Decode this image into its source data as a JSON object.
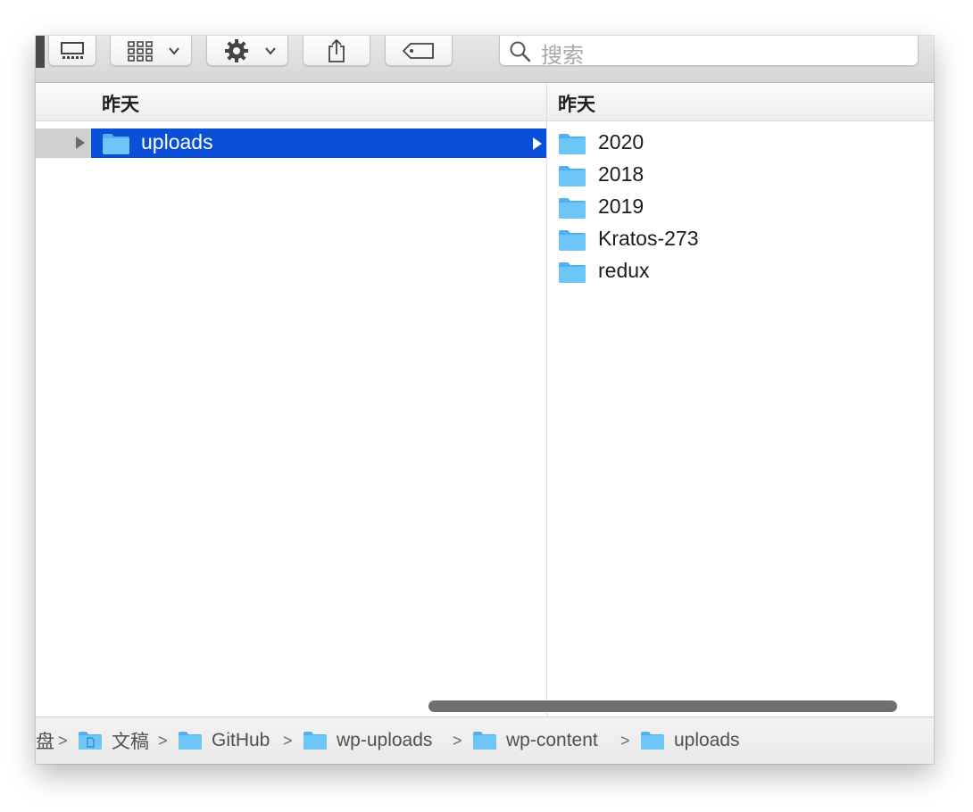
{
  "toolbar": {
    "buttons": [
      {
        "name": "cover-flow-view",
        "icon": "cover-flow-icon"
      },
      {
        "name": "group-view",
        "icon": "grid-icon"
      },
      {
        "name": "action-menu",
        "icon": "gear-icon"
      },
      {
        "name": "share",
        "icon": "share-icon"
      },
      {
        "name": "tags",
        "icon": "tag-icon"
      }
    ],
    "search_placeholder": "搜索"
  },
  "columns": [
    {
      "header": "",
      "selected": true
    },
    {
      "header": "昨天",
      "items": [
        {
          "label": "uploads",
          "selected": true
        }
      ]
    },
    {
      "header": "昨天",
      "items": [
        {
          "label": "2020"
        },
        {
          "label": "2018"
        },
        {
          "label": "2019"
        },
        {
          "label": "Kratos-273"
        },
        {
          "label": "redux"
        }
      ]
    }
  ],
  "pathbar": [
    {
      "label": "盘",
      "icon": "drive-icon"
    },
    {
      "label": "文稿",
      "icon": "documents-folder-icon"
    },
    {
      "label": "GitHub",
      "icon": "folder-icon"
    },
    {
      "label": "wp-uploads",
      "icon": "folder-icon"
    },
    {
      "label": "wp-content",
      "icon": "folder-icon"
    },
    {
      "label": "uploads",
      "icon": "folder-icon"
    }
  ],
  "pathbar_separator": ">",
  "colors": {
    "selection": "#0a4fd8",
    "folder": "#6ec6f8",
    "folder_dark": "#4fb1ef"
  }
}
